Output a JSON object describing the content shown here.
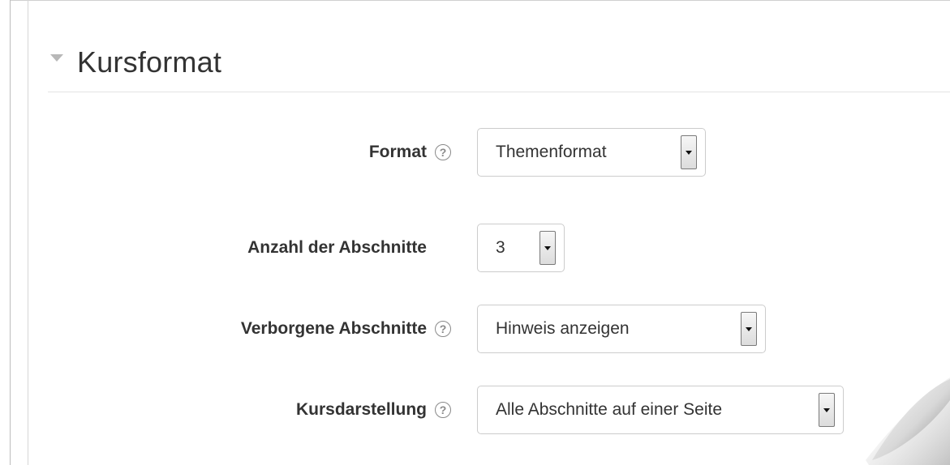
{
  "section": {
    "title": "Kursformat"
  },
  "fields": [
    {
      "label": "Format",
      "value": "Themenformat",
      "has_help": true
    },
    {
      "label": "Anzahl der Abschnitte",
      "value": "3",
      "has_help": false
    },
    {
      "label": "Verborgene Abschnitte",
      "value": "Hinweis anzeigen",
      "has_help": true
    },
    {
      "label": "Kursdarstellung",
      "value": "Alle Abschnitte auf einer Seite",
      "has_help": true
    }
  ],
  "icons": {
    "collapse": "triangle-down-icon",
    "help": "question-mark-icon",
    "dropdown": "arrow-down-icon"
  },
  "help_glyph": "?"
}
